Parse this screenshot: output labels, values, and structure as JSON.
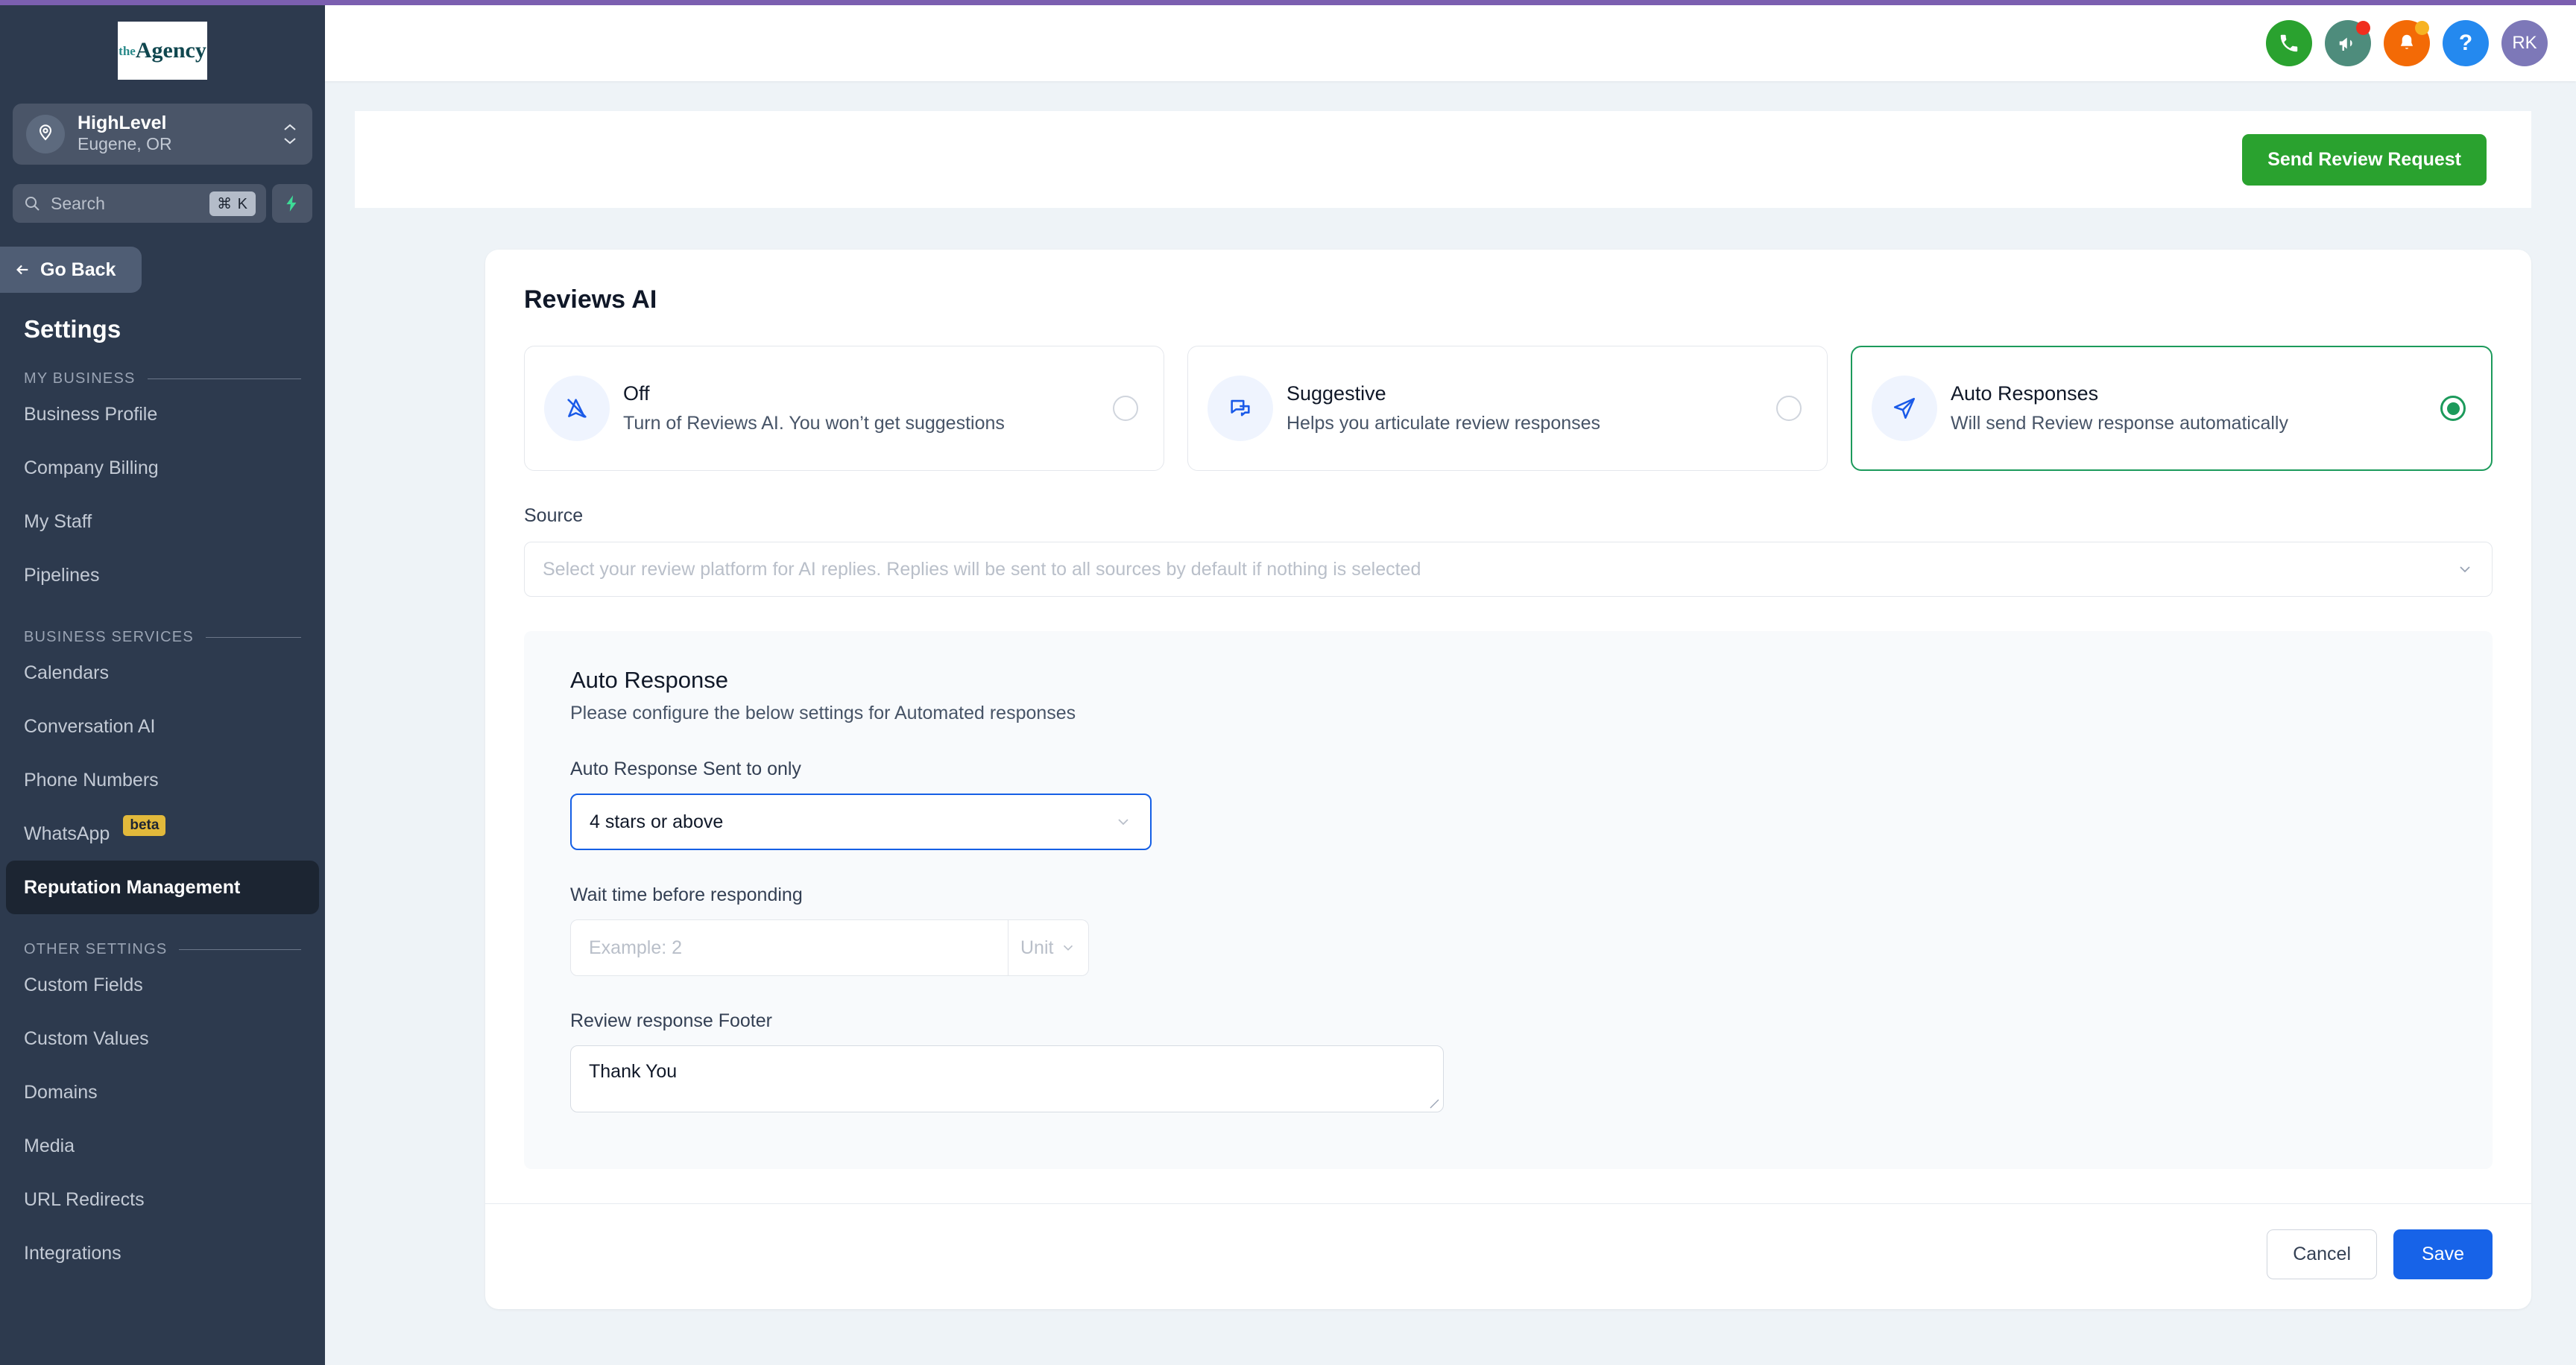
{
  "theme": {
    "accent_purple": "#7b5fb0",
    "sidebar_bg": "#2d3a4e",
    "green": "#2aa22f",
    "radio_green": "#1c9a5b",
    "blue": "#1763e8",
    "focus_blue": "#155fe5",
    "beta_yellow": "#e2b93b"
  },
  "sidebar": {
    "logo": {
      "prefix": "the",
      "name": "Agency"
    },
    "location": {
      "name": "HighLevel",
      "sub": "Eugene, OR"
    },
    "search": {
      "placeholder": "Search",
      "shortcut": "⌘ K"
    },
    "go_back": "Go Back",
    "title": "Settings",
    "sections": [
      {
        "label": "MY BUSINESS",
        "items": [
          {
            "label": "Business Profile",
            "active": false
          },
          {
            "label": "Company Billing",
            "active": false
          },
          {
            "label": "My Staff",
            "active": false
          },
          {
            "label": "Pipelines",
            "active": false
          }
        ]
      },
      {
        "label": "BUSINESS SERVICES",
        "items": [
          {
            "label": "Calendars",
            "active": false
          },
          {
            "label": "Conversation AI",
            "active": false
          },
          {
            "label": "Phone Numbers",
            "active": false
          },
          {
            "label": "WhatsApp",
            "active": false,
            "badge": "beta"
          },
          {
            "label": "Reputation Management",
            "active": true
          }
        ]
      },
      {
        "label": "OTHER SETTINGS",
        "items": [
          {
            "label": "Custom Fields",
            "active": false
          },
          {
            "label": "Custom Values",
            "active": false
          },
          {
            "label": "Domains",
            "active": false
          },
          {
            "label": "Media",
            "active": false
          },
          {
            "label": "URL Redirects",
            "active": false
          },
          {
            "label": "Integrations",
            "active": false
          }
        ]
      }
    ]
  },
  "topbar": {
    "icons": [
      {
        "name": "phone-icon",
        "bg": "#2aa22f",
        "badge": null
      },
      {
        "name": "megaphone-icon",
        "bg": "#4e8c7c",
        "badge": "#f02e1e"
      },
      {
        "name": "bell-icon",
        "bg": "#f36a06",
        "badge": "#f7b322"
      },
      {
        "name": "help-icon",
        "bg": "#2489ef",
        "badge": null
      }
    ],
    "avatar_initials": "RK"
  },
  "action_bar": {
    "send_review_request": "Send Review Request"
  },
  "main": {
    "card_title": "Reviews AI",
    "modes": [
      {
        "id": "off",
        "icon": "navigation-off-icon",
        "title": "Off",
        "desc": "Turn of Reviews AI. You won’t get suggestions",
        "selected": false
      },
      {
        "id": "suggestive",
        "icon": "chat-bubbles-icon",
        "title": "Suggestive",
        "desc": "Helps you articulate review responses",
        "selected": false
      },
      {
        "id": "auto-responses",
        "icon": "paper-plane-icon",
        "title": "Auto Responses",
        "desc": "Will send Review response automatically",
        "selected": true
      }
    ],
    "source": {
      "label": "Source",
      "placeholder": "Select your review platform for AI replies. Replies will be sent to all sources by default if nothing is selected",
      "value": ""
    },
    "auto_response": {
      "title": "Auto Response",
      "subtitle": "Please configure the below settings for Automated responses",
      "sent_to_only": {
        "label": "Auto Response Sent to only",
        "value": "4 stars or above"
      },
      "wait_time": {
        "label": "Wait time before responding",
        "placeholder": "Example: 2",
        "value": "",
        "unit_placeholder": "Unit",
        "unit_value": ""
      },
      "footer_field": {
        "label": "Review response Footer",
        "value": "Thank You"
      }
    },
    "buttons": {
      "cancel": "Cancel",
      "save": "Save"
    }
  }
}
